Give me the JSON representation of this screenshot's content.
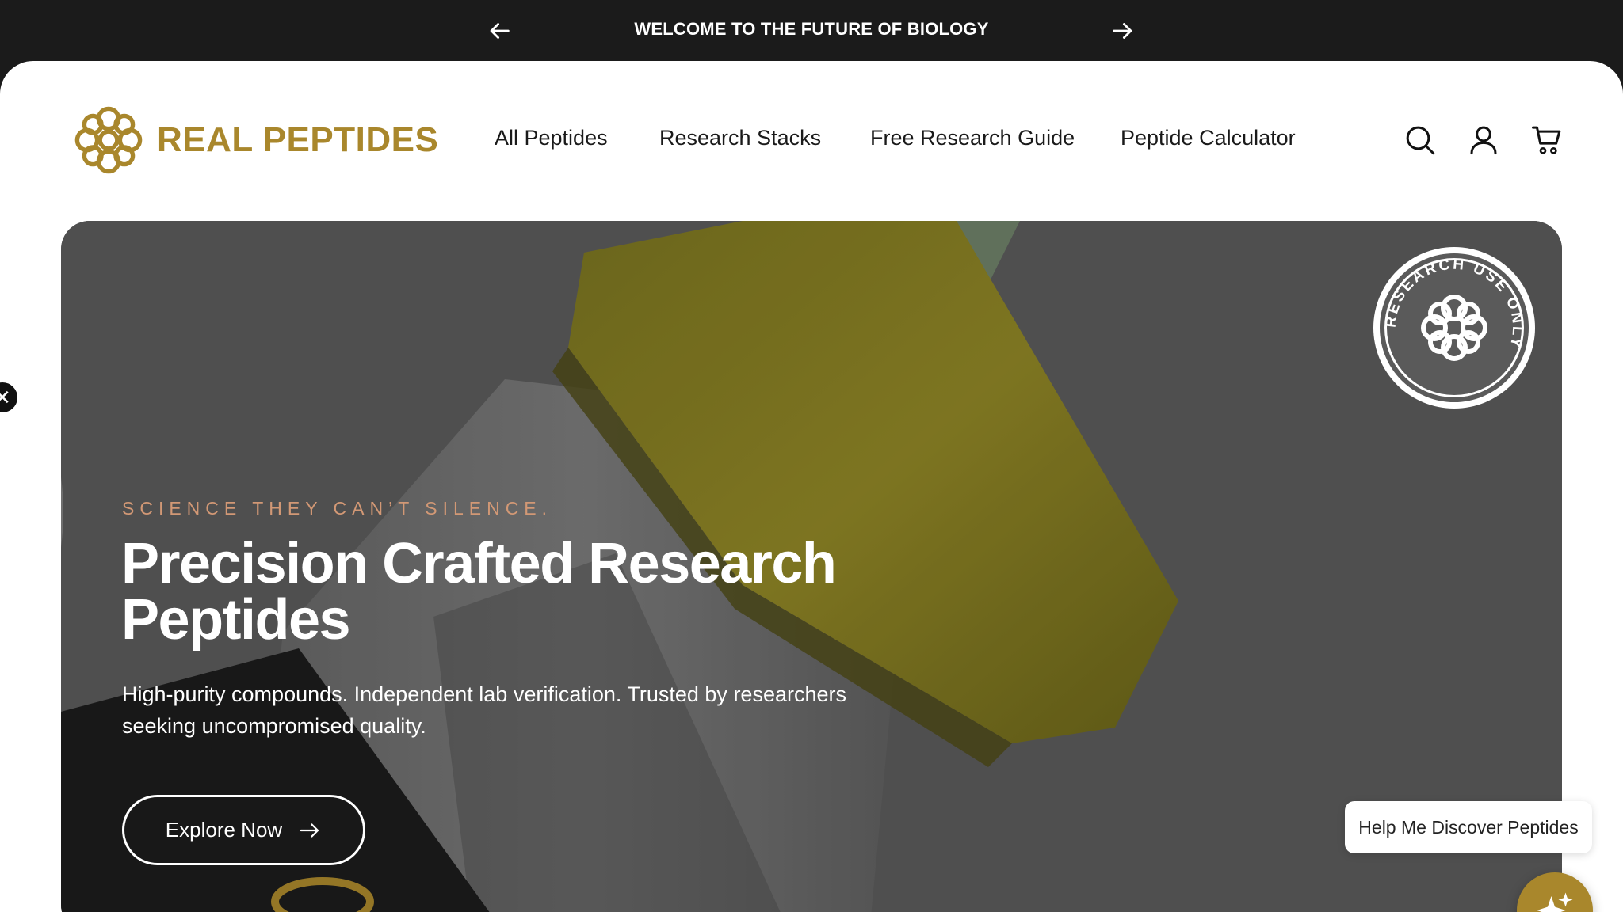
{
  "announcement": {
    "message": "WELCOME TO THE FUTURE OF BIOLOGY",
    "prev_icon": "arrow-left-icon",
    "next_icon": "arrow-right-icon"
  },
  "header": {
    "brand": "REAL PEPTIDES",
    "brand_color": "#a9872c",
    "nav": [
      "All Peptides",
      "Research Stacks",
      "Free Research Guide",
      "Peptide Calculator"
    ],
    "icons": [
      "search-icon",
      "account-icon",
      "cart-icon"
    ]
  },
  "hero": {
    "eyebrow": "SCIENCE THEY CAN’T SILENCE.",
    "headline": "Precision Crafted Research Peptides",
    "subtext": "High-purity compounds. Independent lab verification. Trusted by researchers seeking uncompromised quality.",
    "cta_label": "Explore Now",
    "badge_text": "RESEARCH USE ONLY",
    "eyebrow_color": "#d29875"
  },
  "widgets": {
    "help_label": "Help Me Discover Peptides",
    "close_glyph": "✕",
    "ai_icon": "sparkle-icon"
  }
}
